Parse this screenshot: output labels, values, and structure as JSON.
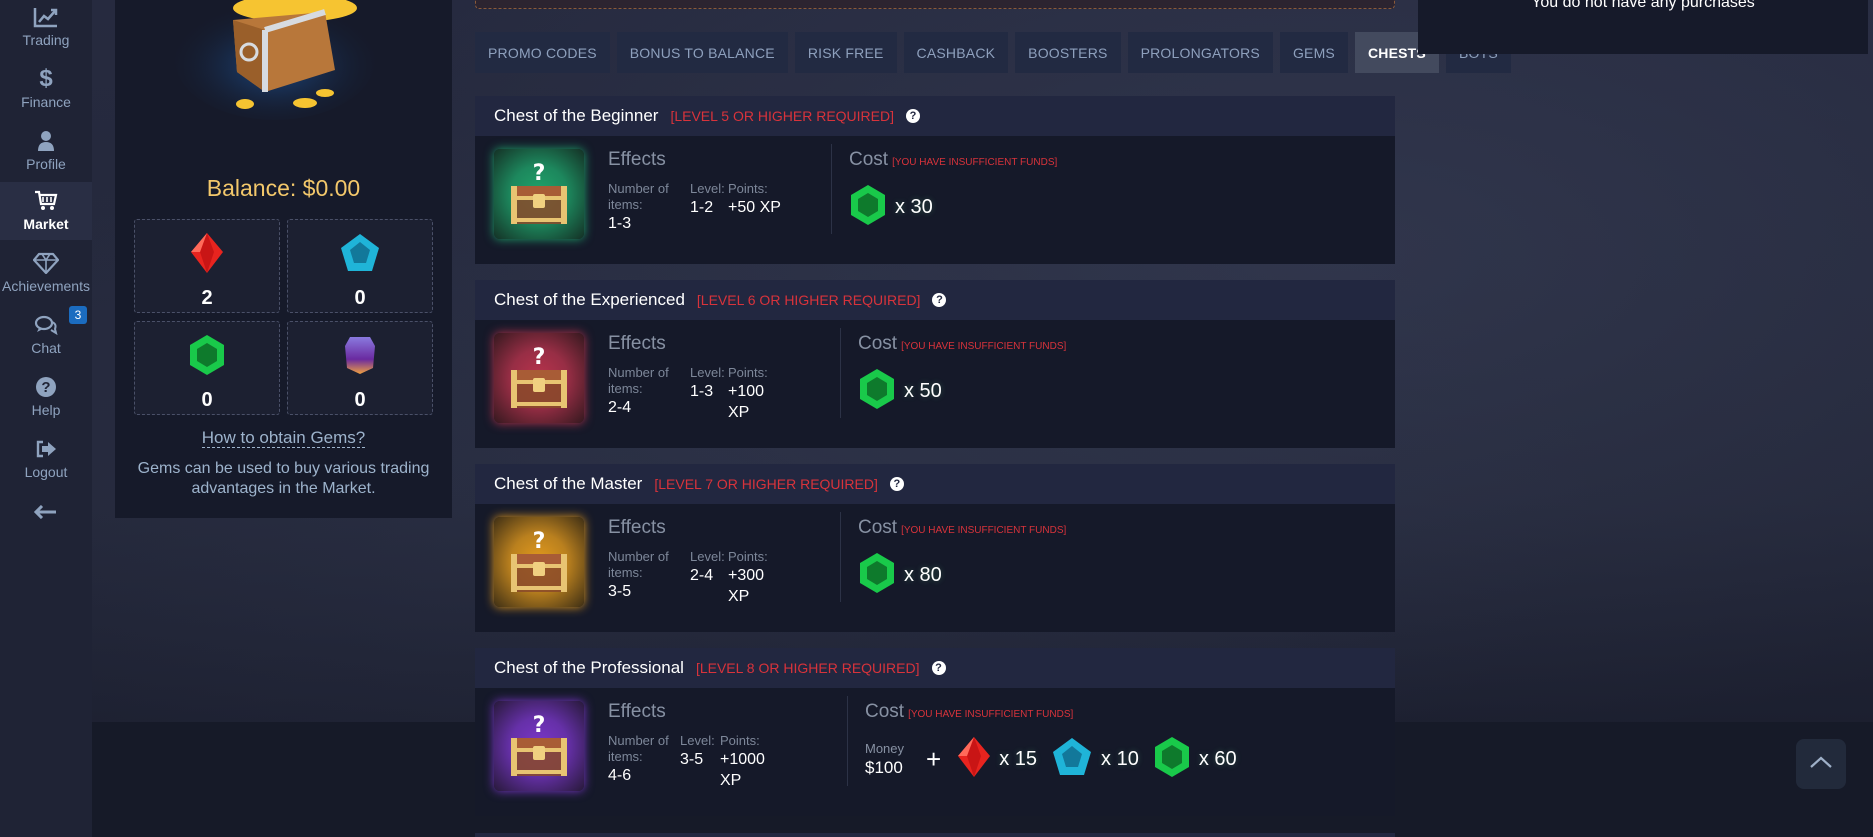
{
  "sidebar": {
    "items": [
      {
        "label": "Trading",
        "icon": "chart-line-icon"
      },
      {
        "label": "Finance",
        "icon": "dollar-icon"
      },
      {
        "label": "Profile",
        "icon": "user-icon"
      },
      {
        "label": "Market",
        "icon": "cart-icon",
        "active": true
      },
      {
        "label": "Achievements",
        "icon": "diamond-icon"
      },
      {
        "label": "Chat",
        "icon": "chat-icon",
        "badge": "3"
      },
      {
        "label": "Help",
        "icon": "help-icon"
      },
      {
        "label": "Logout",
        "icon": "logout-icon"
      }
    ],
    "collapse_icon": "arrow-left-icon"
  },
  "wallet": {
    "balance_label": "Balance: $0.00",
    "gems": [
      {
        "type": "red",
        "count": "2"
      },
      {
        "type": "blue",
        "count": "0"
      },
      {
        "type": "green",
        "count": "0"
      },
      {
        "type": "purple",
        "count": "0"
      }
    ],
    "obtain_link": "How to obtain Gems?",
    "description": "Gems can be used to buy various trading advantages in the Market."
  },
  "tabs": [
    {
      "label": "PROMO CODES"
    },
    {
      "label": "BONUS TO BALANCE"
    },
    {
      "label": "RISK FREE"
    },
    {
      "label": "CASHBACK"
    },
    {
      "label": "BOOSTERS"
    },
    {
      "label": "PROLONGATORS"
    },
    {
      "label": "GEMS"
    },
    {
      "label": "CHESTS",
      "active": true
    },
    {
      "label": "BOTS"
    }
  ],
  "labels": {
    "effects": "Effects",
    "cost": "Cost",
    "insufficient": "[YOU HAVE INSUFFICIENT FUNDS]",
    "level": "Level:",
    "points": "Points:",
    "money": "Money",
    "plus": "+",
    "help_glyph": "?"
  },
  "chests": [
    {
      "title": "Chest of the Beginner",
      "requirement": "[LEVEL 5 OR HIGHER REQUIRED]",
      "color": "#1fa36a",
      "items_label": "Number of items:",
      "items": "1-3",
      "level": "1-2",
      "points": "+50 XP",
      "cost": [
        {
          "gem": "green",
          "qty": "x 30"
        }
      ]
    },
    {
      "title": "Chest of the Experienced",
      "requirement": "[LEVEL 6 OR HIGHER REQUIRED]",
      "color": "#b8334c",
      "items_label": "Number of items:",
      "items": "2-4",
      "level": "1-3",
      "points": "+100 XP",
      "cost": [
        {
          "gem": "green",
          "qty": "x 50"
        }
      ]
    },
    {
      "title": "Chest of the Master",
      "requirement": "[LEVEL 7 OR HIGHER REQUIRED]",
      "color": "#e39a1c",
      "items_label": "Number of items:",
      "items": "3-5",
      "level": "2-4",
      "points": "+300 XP",
      "cost": [
        {
          "gem": "green",
          "qty": "x 80"
        }
      ]
    },
    {
      "title": "Chest of the Professional",
      "requirement": "[LEVEL 8 OR HIGHER REQUIRED]",
      "color": "#7a36c8",
      "items_label": "Number of items:",
      "items": "4-6",
      "level": "3-5",
      "points": "+1000 XP",
      "money": "$100",
      "cost": [
        {
          "gem": "red",
          "qty": "x 15"
        },
        {
          "gem": "blue",
          "qty": "x 10"
        },
        {
          "gem": "green",
          "qty": "x 60"
        }
      ]
    }
  ],
  "purchases": {
    "empty_text": "You do not have any purchases"
  }
}
